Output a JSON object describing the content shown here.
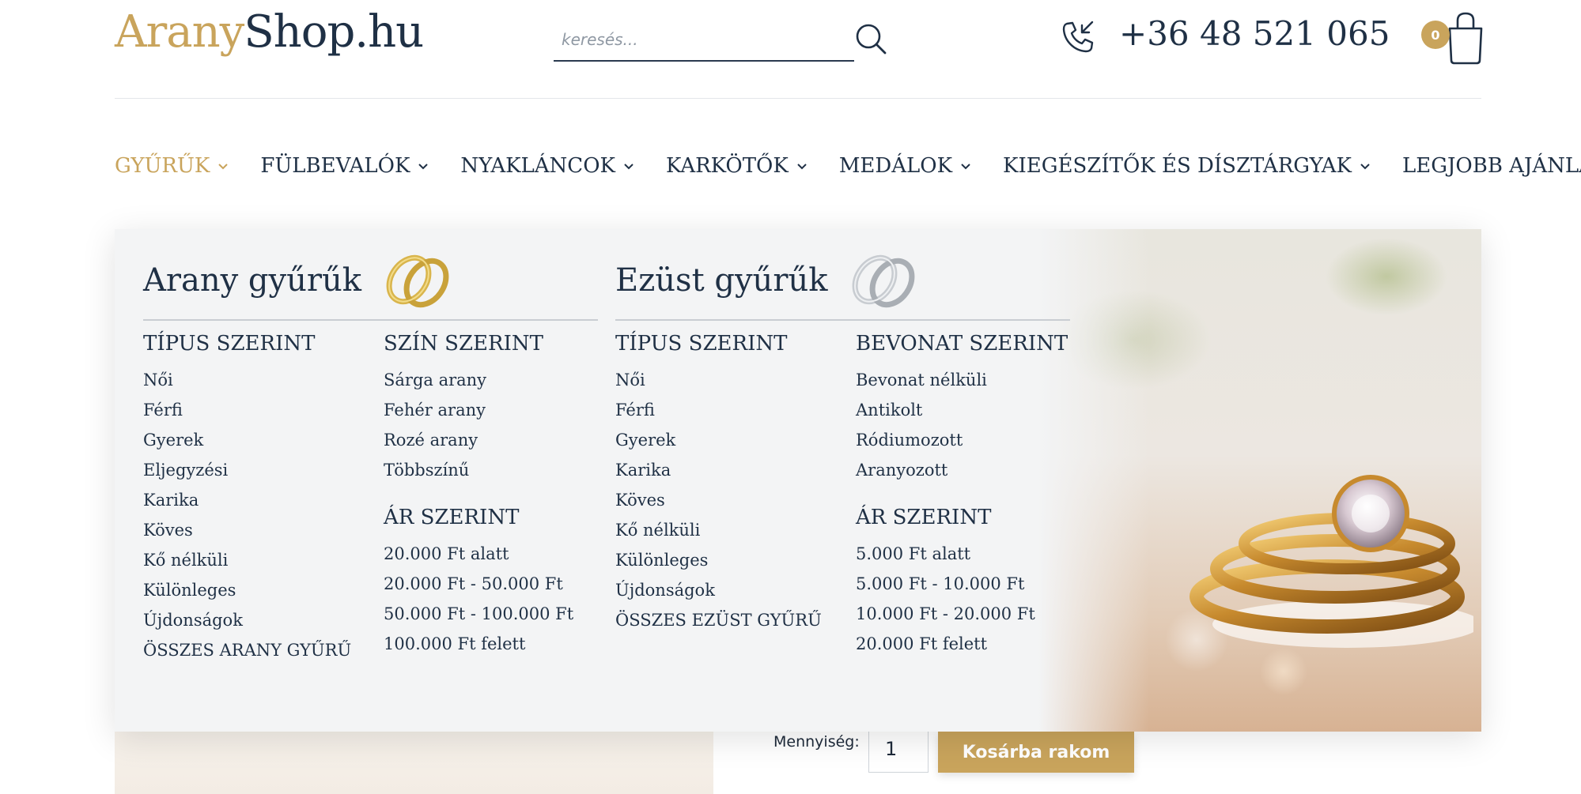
{
  "header": {
    "logo_part1": "Arany",
    "logo_part2": "Shop.hu",
    "search_placeholder": "keresés...",
    "search_icon": "search-icon",
    "phone_icon": "phone-incoming-icon",
    "phone": "+36 48 521 065",
    "cart_icon": "shopping-bag-icon",
    "cart_count": "0"
  },
  "nav": {
    "items": [
      {
        "label": "GYŰRŰK",
        "active": true
      },
      {
        "label": "FÜLBEVALÓK",
        "active": false
      },
      {
        "label": "NYAKLÁNCOK",
        "active": false
      },
      {
        "label": "KARKÖTŐK",
        "active": false
      },
      {
        "label": "MEDÁLOK",
        "active": false
      },
      {
        "label": "KIEGÉSZÍTŐK ÉS DÍSZTÁRGYAK",
        "active": false
      },
      {
        "label": "LEGJOBB AJÁNLATOK",
        "active": false
      }
    ]
  },
  "mega_menu": {
    "gold": {
      "title": "Arany gyűrűk",
      "icon": "gold-rings-icon",
      "by_type": {
        "heading": "TÍPUS SZERINT",
        "items": [
          "Női",
          "Férfi",
          "Gyerek",
          "Eljegyzési",
          "Karika",
          "Köves",
          "Kő nélküli",
          "Különleges",
          "Újdonságok",
          "ÖSSZES ARANY GYŰRŰ"
        ]
      },
      "by_color": {
        "heading": "SZÍN SZERINT",
        "items": [
          "Sárga arany",
          "Fehér arany",
          "Rozé arany",
          "Többszínű"
        ]
      },
      "by_price": {
        "heading": "ÁR SZERINT",
        "items": [
          "20.000 Ft alatt",
          "20.000 Ft - 50.000 Ft",
          "50.000 Ft - 100.000 Ft",
          "100.000 Ft felett"
        ]
      }
    },
    "silver": {
      "title": "Ezüst gyűrűk",
      "icon": "silver-rings-icon",
      "by_type": {
        "heading": "TÍPUS SZERINT",
        "items": [
          "Női",
          "Férfi",
          "Gyerek",
          "Karika",
          "Köves",
          "Kő nélküli",
          "Különleges",
          "Újdonságok",
          "ÖSSZES EZÜST GYŰRŰ"
        ]
      },
      "by_coating": {
        "heading": "BEVONAT SZERINT",
        "items": [
          "Bevonat nélküli",
          "Antikolt",
          "Ródiumozott",
          "Aranyozott"
        ]
      },
      "by_price": {
        "heading": "ÁR SZERINT",
        "items": [
          "5.000 Ft alatt",
          "5.000 Ft - 10.000 Ft",
          "10.000 Ft - 20.000 Ft",
          "20.000 Ft felett"
        ]
      }
    }
  },
  "product": {
    "qty_label": "Mennyiség:",
    "qty_value": "1",
    "add_to_cart": "Kosárba rakom"
  },
  "colors": {
    "accent": "#c9a45c",
    "text": "#1f3045",
    "menu_bg": "#f3f4f5"
  }
}
